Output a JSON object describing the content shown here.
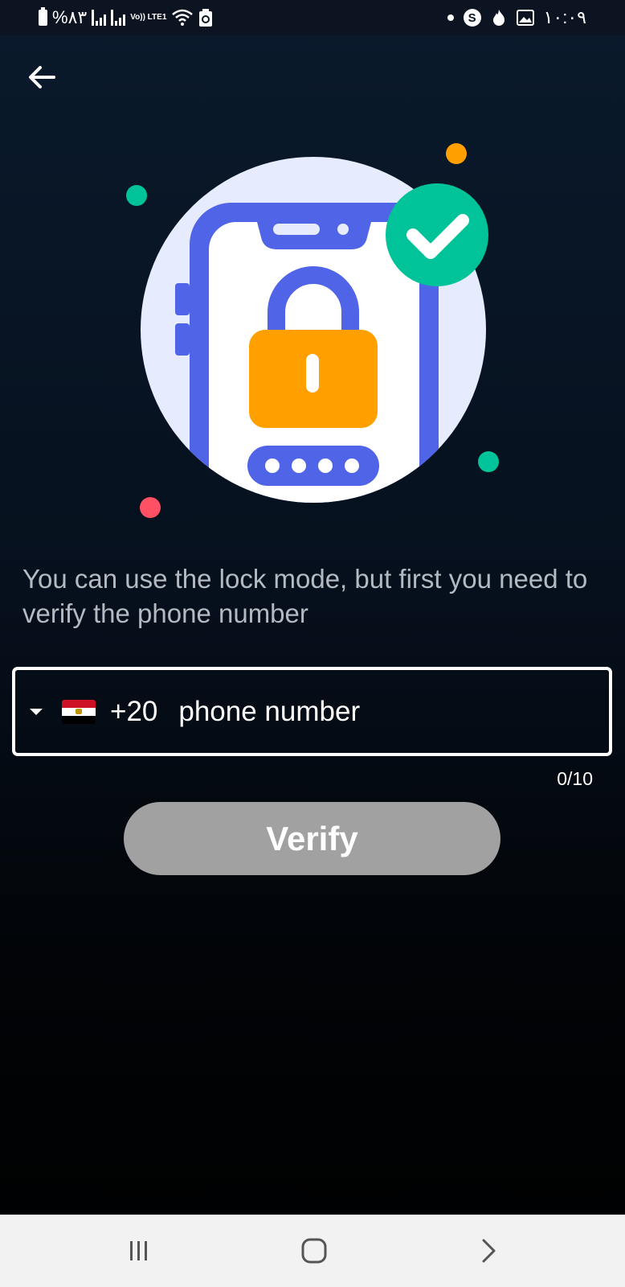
{
  "status_bar": {
    "battery_text": "%٨٣",
    "network_label": "Vo)) LTE1",
    "time": "١٠:٠٩",
    "icons": [
      "battery-icon",
      "signal-icon",
      "wifi-icon",
      "recycle-icon",
      "dot-icon",
      "s-icon",
      "flame-icon",
      "image-icon"
    ]
  },
  "header": {
    "back_icon": "arrow-left-icon"
  },
  "illustration": {
    "name": "phone-lock-verified",
    "colors": {
      "circle": "#e6ecfd",
      "phone": "#4f64e7",
      "lock": "#ffa000",
      "check": "#00c39a",
      "dot_orange": "#ffa000",
      "dot_green": "#00c39a",
      "dot_red": "#ff5064"
    }
  },
  "main": {
    "message": "You can use the lock mode, but first you need to verify the phone number",
    "country_flag": "egypt-flag",
    "dial_code": "+20",
    "phone_placeholder": "phone number",
    "phone_value": "",
    "counter": "0/10",
    "verify_label": "Verify"
  },
  "nav_bar": {
    "recent_icon": "recent-apps-icon",
    "home_icon": "home-icon",
    "back_icon": "chevron-right-icon"
  },
  "theme": {
    "accent_disabled": "#a1a1a1",
    "background_top": "#0a1a2c",
    "background_bottom": "#000000"
  }
}
